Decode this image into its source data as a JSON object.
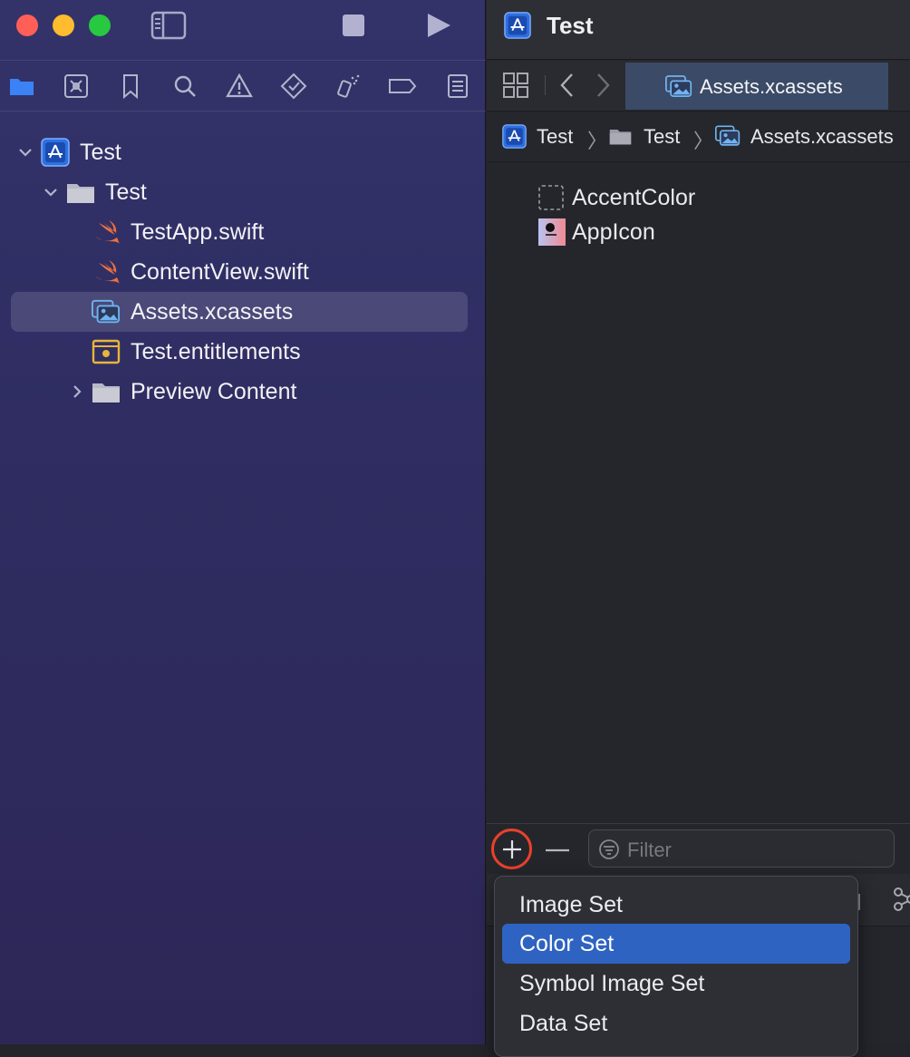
{
  "window": {
    "title": "Test"
  },
  "toolbar": {
    "close_label": "Close",
    "minimize_label": "Minimize",
    "zoom_label": "Zoom",
    "icons": [
      "sidebar-toggle-icon",
      "stop-icon",
      "run-icon"
    ]
  },
  "navigator_icons": [
    "folder-icon",
    "source-control-icon",
    "bookmark-icon",
    "search-icon",
    "warning-icon",
    "test-icon",
    "debug-icon",
    "breakpoint-icon",
    "report-icon"
  ],
  "tree": {
    "items": [
      {
        "label": "Test",
        "icon": "app-project-icon",
        "expanded": true
      },
      {
        "label": "Test",
        "icon": "folder-icon",
        "expanded": true
      },
      {
        "label": "TestApp.swift",
        "icon": "swift-icon"
      },
      {
        "label": "ContentView.swift",
        "icon": "swift-icon"
      },
      {
        "label": "Assets.xcassets",
        "icon": "assets-icon",
        "selected": true
      },
      {
        "label": "Test.entitlements",
        "icon": "entitlements-icon"
      },
      {
        "label": "Preview Content",
        "icon": "folder-icon",
        "expanded": false
      }
    ]
  },
  "editor": {
    "project_title": "Test",
    "active_tab": "Assets.xcassets",
    "breadcrumb": [
      "Test",
      "Test",
      "Assets.xcassets"
    ],
    "assets": [
      {
        "label": "AccentColor",
        "icon": "color-set-icon"
      },
      {
        "label": "AppIcon",
        "icon": "app-icon-set-icon"
      }
    ],
    "filter_placeholder": "Filter"
  },
  "add_menu": {
    "items": [
      "Image Set",
      "Color Set",
      "Symbol Image Set",
      "Data Set"
    ],
    "highlighted": "Color Set"
  },
  "colors": {
    "accent": "#2f63c2",
    "highlight_circle": "#e8412c"
  }
}
